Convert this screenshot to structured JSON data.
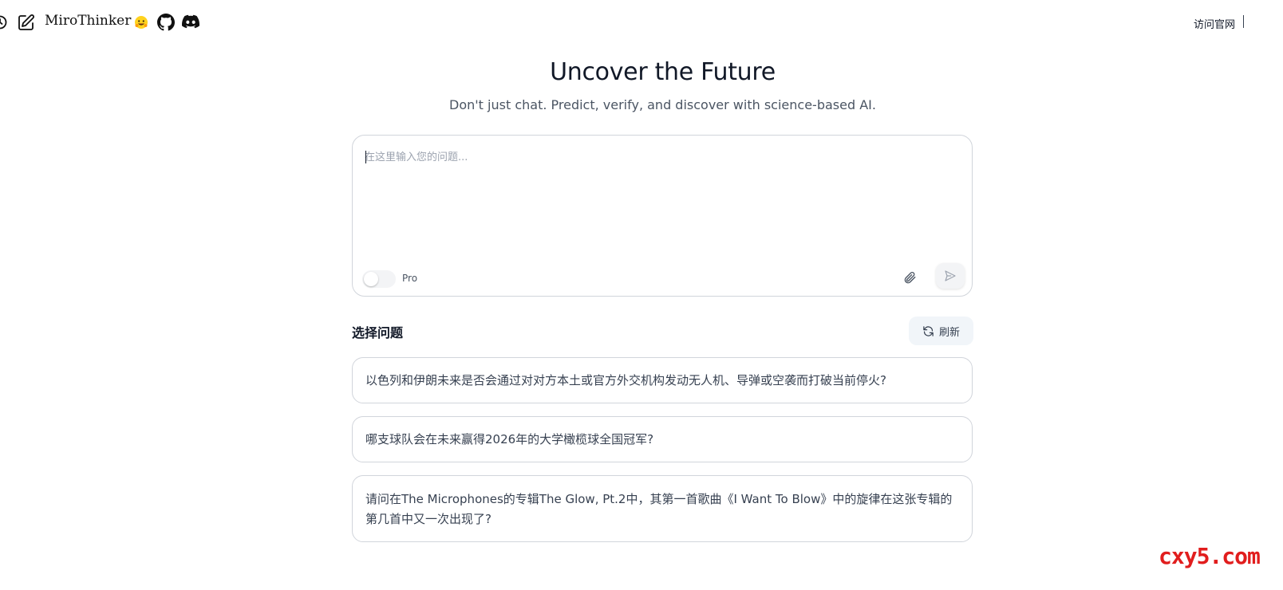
{
  "header": {
    "brand": "MiroThinker",
    "visit_link": "访问官网"
  },
  "hero": {
    "title": "Uncover the Future",
    "subtitle": "Don't just chat. Predict, verify, and discover with science-based AI."
  },
  "composer": {
    "placeholder": "在这里输入您的问题...",
    "pro_label": "Pro",
    "pro_enabled": false
  },
  "questions": {
    "section_title": "选择问题",
    "refresh_label": "刷新",
    "items": [
      "以色列和伊朗未来是否会通过对对方本土或官方外交机构发动无人机、导弹或空袭而打破当前停火?",
      "哪支球队会在未来赢得2026年的大学橄榄球全国冠军?",
      "请问在The Microphones的专辑The Glow, Pt.2中，其第一首歌曲《I Want To Blow》中的旋律在这张专辑的第几首中又一次出现了?"
    ]
  },
  "watermark": "cxy5.com",
  "icons": {
    "history": "history-icon",
    "edit": "edit-icon",
    "huggingface": "hugging-face-icon",
    "github": "github-icon",
    "discord": "discord-icon",
    "attach": "paperclip-icon",
    "send": "send-icon",
    "refresh": "refresh-icon"
  },
  "colors": {
    "accent_watermark": "#e11d1d",
    "border": "#d1d5db",
    "muted_text": "#4b5563"
  }
}
